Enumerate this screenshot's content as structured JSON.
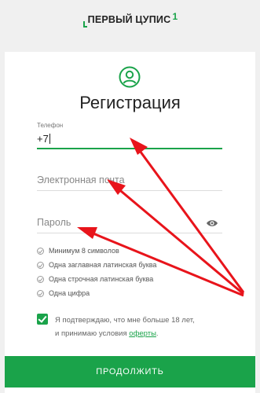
{
  "logo": {
    "text": "ПЕРВЫЙ ЦУПИС",
    "sup": "1"
  },
  "title": "Регистрация",
  "icons": {
    "avatar": "user-circle-icon",
    "eye": "eye-icon",
    "check": "check-icon"
  },
  "phone": {
    "label": "Телефон",
    "value": "+7"
  },
  "email": {
    "placeholder": "Электронная почта"
  },
  "password": {
    "placeholder": "Пароль"
  },
  "requirements": [
    "Минимум 8 символов",
    "Одна заглавная латинская буква",
    "Одна строчная латинская буква",
    "Одна цифра"
  ],
  "agreement": {
    "line1": "Я подтверждаю, что мне больше 18 лет,",
    "line2_prefix": "и принимаю условия",
    "link": "оферты",
    "line2_suffix": ".",
    "checked": true
  },
  "submit_label": "ПРОДОЛЖИТЬ",
  "colors": {
    "accent": "#1aa34a",
    "annotation": "#e8141b"
  }
}
